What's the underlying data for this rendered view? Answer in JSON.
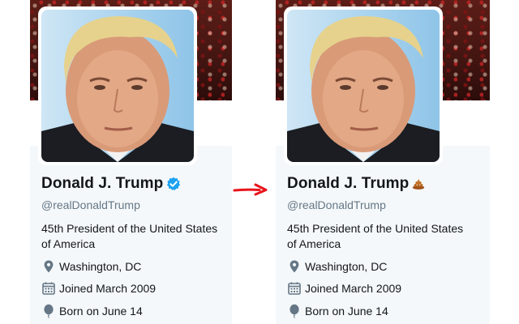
{
  "profiles": [
    {
      "name": "Donald J. Trump",
      "name_icon": "verified-badge-icon",
      "handle": "@realDonaldTrump",
      "bio": "45th President of the United States of America",
      "location": "Washington, DC",
      "joined": "Joined March 2009",
      "born": "Born on June 14"
    },
    {
      "name": "Donald J. Trump",
      "name_icon": "poop-emoji-icon",
      "handle": "@realDonaldTrump",
      "bio": "45th President of the United States of America",
      "location": "Washington, DC",
      "joined": "Joined March 2009",
      "born": "Born on June 14"
    }
  ],
  "arrow_icon": "right-arrow-icon",
  "colors": {
    "verified_blue": "#1da1f2",
    "card_bg": "#f5f8fa",
    "arrow_red": "#e8141b",
    "secondary_text": "#657786",
    "poop_brown": "#b5651d"
  }
}
